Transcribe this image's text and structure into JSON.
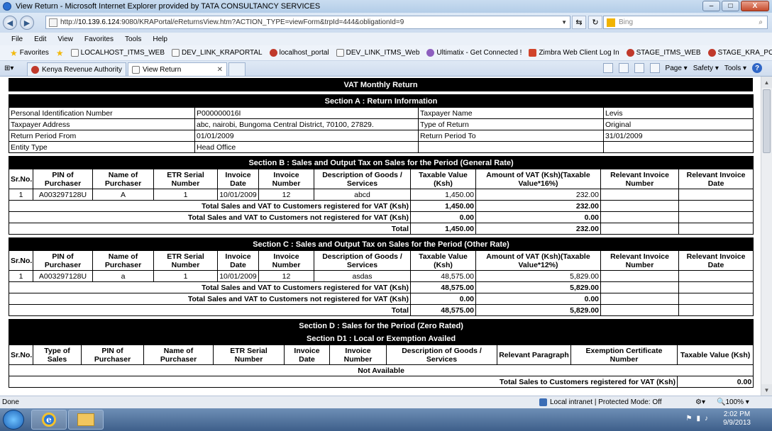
{
  "window": {
    "title": "View Return - Microsoft Internet Explorer provided by TATA CONSULTANCY SERVICES",
    "controls": [
      "–",
      "□",
      "X"
    ]
  },
  "address": {
    "url_prefix": "http://",
    "host": "10.139.6.124",
    "url_rest": ":9080/KRAPortal/eReturnsView.htm?ACTION_TYPE=viewForm&trpId=444&obligationId=9",
    "search_placeholder": "Bing"
  },
  "menu": [
    "File",
    "Edit",
    "View",
    "Favorites",
    "Tools",
    "Help"
  ],
  "favorites": {
    "label": "Favorites",
    "links": [
      "LOCALHOST_ITMS_WEB",
      "DEV_LINK_KRAPORTAL",
      "localhost_portal",
      "DEV_LINK_ITMS_Web",
      "Ultimatix - Get Connected !",
      "Zimbra Web Client Log In",
      "STAGE_ITMS_WEB",
      "STAGE_KRA_PORTAL"
    ]
  },
  "tabs": [
    {
      "label": "Kenya Revenue Authority"
    },
    {
      "label": "View Return"
    }
  ],
  "commands": {
    "page": "Page ▾",
    "safety": "Safety ▾",
    "tools": "Tools ▾"
  },
  "page": {
    "title": "VAT Monthly Return",
    "section_a": {
      "title": "Section A : Return Information",
      "rows": [
        {
          "l1": "Personal Identification Number",
          "v1": "P000000016I",
          "l2": "Taxpayer Name",
          "v2": "Levis"
        },
        {
          "l1": "Taxpayer Address",
          "v1": "abc, nairobi, Bungoma Central District, 70100, 27829.",
          "l2": "Type of Return",
          "v2": "Original"
        },
        {
          "l1": "Return Period From",
          "v1": "01/01/2009",
          "l2": "Return Period To",
          "v2": "31/01/2009"
        },
        {
          "l1": "Entity Type",
          "v1": "Head Office",
          "l2": "",
          "v2": ""
        }
      ]
    },
    "section_b": {
      "title": "Section B : Sales and Output Tax on Sales for the Period (General Rate)",
      "headers": [
        "Sr.No.",
        "PIN of Purchaser",
        "Name of Purchaser",
        "ETR Serial Number",
        "Invoice Date",
        "Invoice Number",
        "Description of Goods / Services",
        "Taxable Value (Ksh)",
        "Amount of VAT (Ksh)(Taxable Value*16%)",
        "Relevant Invoice Number",
        "Relevant Invoice Date"
      ],
      "row": [
        "1",
        "A003297128U",
        "A",
        "1",
        "10/01/2009",
        "12",
        "abcd",
        "1,450.00",
        "232.00",
        "",
        ""
      ],
      "totals": [
        {
          "label": "Total Sales and VAT to Customers registered for VAT (Ksh)",
          "taxable": "1,450.00",
          "vat": "232.00"
        },
        {
          "label": "Total Sales and VAT to Customers not registered for VAT (Ksh)",
          "taxable": "0.00",
          "vat": "0.00"
        },
        {
          "label": "Total",
          "taxable": "1,450.00",
          "vat": "232.00"
        }
      ]
    },
    "section_c": {
      "title": "Section C : Sales and Output Tax on Sales for the Period (Other Rate)",
      "headers": [
        "Sr.No.",
        "PIN of Purchaser",
        "Name of Purchaser",
        "ETR Serial Number",
        "Invoice Date",
        "Invoice Number",
        "Description of Goods / Services",
        "Taxable Value (Ksh)",
        "Amount of VAT (Ksh)(Taxable Value*12%)",
        "Relevant Invoice Number",
        "Relevant Invoice Date"
      ],
      "row": [
        "1",
        "A003297128U",
        "a",
        "1",
        "10/01/2009",
        "12",
        "asdas",
        "48,575.00",
        "5,829.00",
        "",
        ""
      ],
      "totals": [
        {
          "label": "Total Sales and VAT to Customers registered for VAT (Ksh)",
          "taxable": "48,575.00",
          "vat": "5,829.00"
        },
        {
          "label": "Total Sales and VAT to Customers not registered for VAT (Ksh)",
          "taxable": "0.00",
          "vat": "0.00"
        },
        {
          "label": "Total",
          "taxable": "48,575.00",
          "vat": "5,829.00"
        }
      ]
    },
    "section_d": {
      "title": "Section D : Sales for the Period (Zero Rated)",
      "subtitle": "Section D1 : Local or Exemption Availed",
      "headers": [
        "Sr.No.",
        "Type of Sales",
        "PIN of Purchaser",
        "Name of Purchaser",
        "ETR Serial Number",
        "Invoice Date",
        "Invoice Number",
        "Description of Goods / Services",
        "Relevant Paragraph",
        "Exemption Certificate Number",
        "Taxable Value (Ksh)"
      ],
      "empty": "Not Available",
      "total_label": "Total Sales to Customers registered for VAT (Ksh)",
      "total_value": "0.00"
    }
  },
  "status": {
    "left": "Done",
    "zone": "Local intranet | Protected Mode: Off",
    "zoom": "100%"
  },
  "taskbar": {
    "time": "2:02 PM",
    "date": "9/9/2013"
  }
}
